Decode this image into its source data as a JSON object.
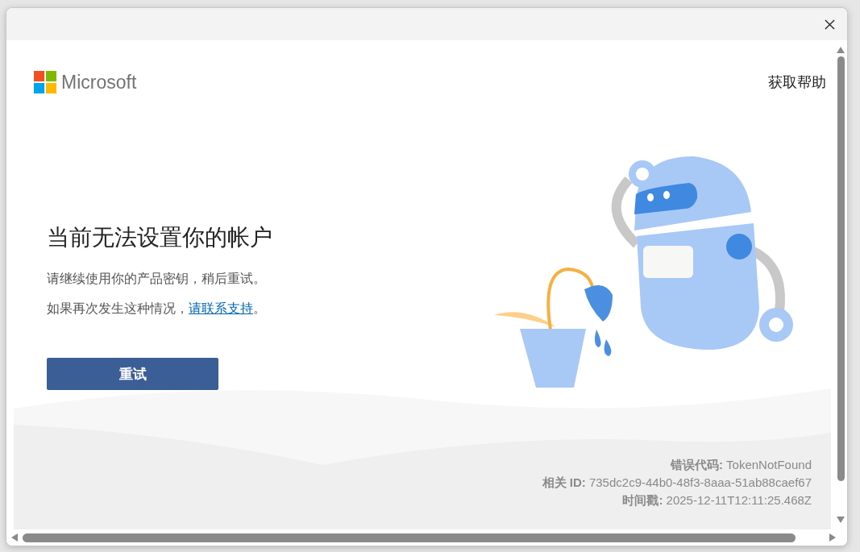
{
  "header": {
    "brand": "Microsoft",
    "help_link": "获取帮助"
  },
  "message": {
    "title": "当前无法设置你的帐户",
    "line_1": "请继续使用你的产品密钥，稍后重试。",
    "line_2": "如果再次发生这种情况，",
    "link": "请联系支持",
    "line_2_end": "。"
  },
  "retry_button": "重试",
  "details": [
    "**错误代码:** TokenNotFound",
    "**相关 ID:** 735dc2c9-44b0-48f3-8aaa-51ab88caef67",
    "**时间戳:** 2025-12-11T12:11:25.468Z"
  ]
}
